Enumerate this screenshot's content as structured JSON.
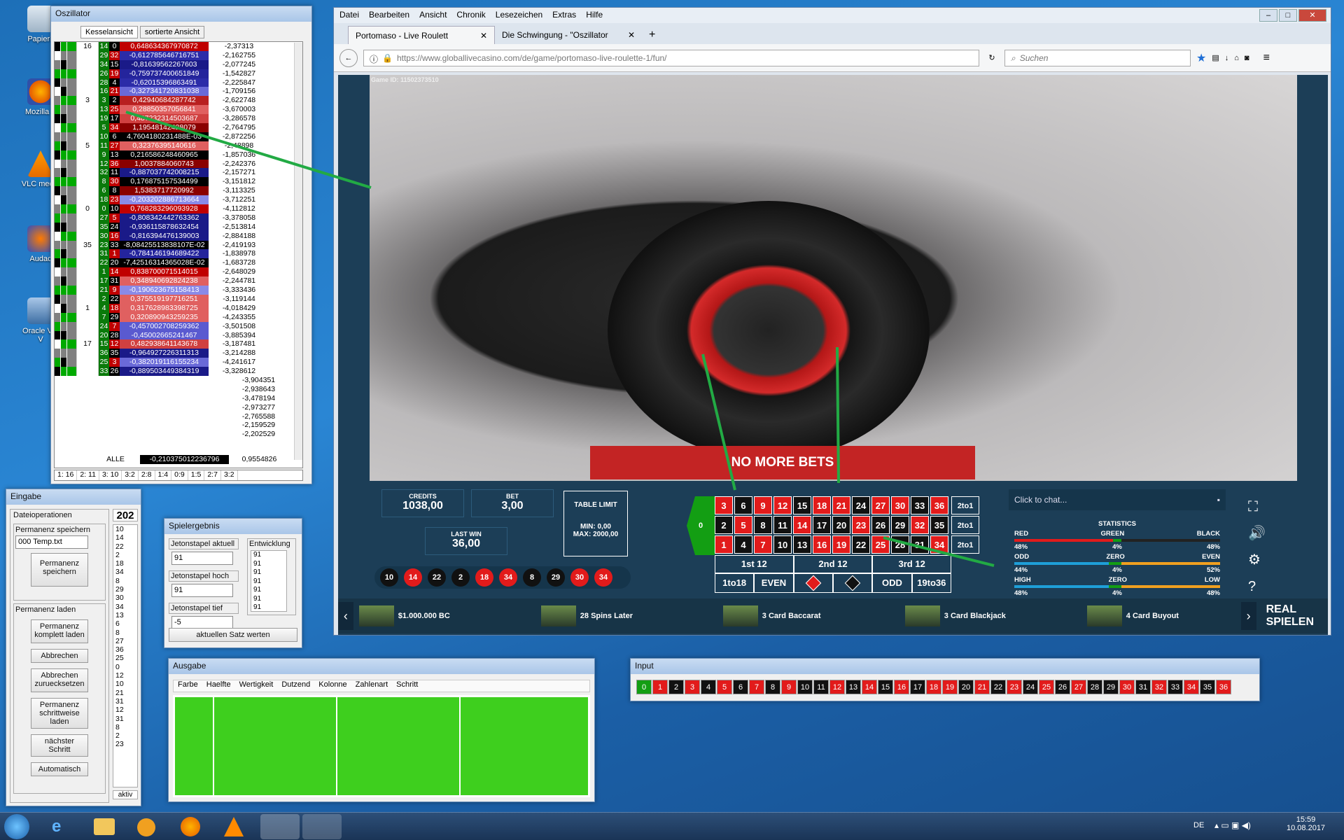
{
  "desktop": {
    "icons": [
      "Papierk",
      "Mozilla F",
      "VLC media",
      "Audac",
      "Oracle VM V"
    ]
  },
  "osz": {
    "title": "Oszillator",
    "tabs": [
      "Kesselansicht",
      "sortierte Ansicht"
    ],
    "groups": [
      "16",
      "3",
      "5",
      "0",
      "35",
      "1",
      "17"
    ],
    "rows": [
      {
        "n1": "14",
        "n2": "0",
        "v": "0,648634367970872",
        "v2": "-2,37313",
        "bg": "#c00000"
      },
      {
        "n1": "29",
        "n2": "32",
        "v": "-0,612785646716751",
        "v2": "-2,162755",
        "bg": "#2c2ca8"
      },
      {
        "n1": "34",
        "n2": "15",
        "v": "-0,81639562267603",
        "v2": "-2,077245",
        "bg": "#1a1a88"
      },
      {
        "n1": "26",
        "n2": "19",
        "v": "-0,759737400651849",
        "v2": "-1,542827",
        "bg": "#24249c"
      },
      {
        "n1": "28",
        "n2": "4",
        "v": "-0,62015396863491",
        "v2": "-2,225847",
        "bg": "#2c2ca8"
      },
      {
        "n1": "16",
        "n2": "21",
        "v": "-0,327341720831038",
        "v2": "-1,709156",
        "bg": "#6a6ad8"
      },
      {
        "n1": "3",
        "n2": "2",
        "v": "0,42940684287742",
        "v2": "-2,622748",
        "bg": "#b82020"
      },
      {
        "n1": "13",
        "n2": "25",
        "v": "0,28850357056841",
        "v2": "-3,670003",
        "bg": "#e06060"
      },
      {
        "n1": "19",
        "n2": "17",
        "v": "0,487232314503687",
        "v2": "-3,286578",
        "bg": "#d04040"
      },
      {
        "n1": "5",
        "n2": "34",
        "v": "1,19548142428079",
        "v2": "-2,764795",
        "bg": "#8a0000"
      },
      {
        "n1": "10",
        "n2": "6",
        "v": "4,7604180231488E-03",
        "v2": "-2,872256",
        "bg": "#000000"
      },
      {
        "n1": "11",
        "n2": "27",
        "v": "0,32376395140616",
        "v2": "-2,48898",
        "bg": "#e06060"
      },
      {
        "n1": "9",
        "n2": "13",
        "v": "0,216586248460965",
        "v2": "-1,857036",
        "bg": "#000000"
      },
      {
        "n1": "12",
        "n2": "36",
        "v": "1,0037884060743",
        "v2": "-2,242376",
        "bg": "#8a0000"
      },
      {
        "n1": "32",
        "n2": "11",
        "v": "-0,887037742008215",
        "v2": "-2,157271",
        "bg": "#1a1a88"
      },
      {
        "n1": "8",
        "n2": "30",
        "v": "0,176875157534499",
        "v2": "-3,151812",
        "bg": "#000000"
      },
      {
        "n1": "6",
        "n2": "8",
        "v": "1,5383717720992",
        "v2": "-3,113325",
        "bg": "#8a0000"
      },
      {
        "n1": "18",
        "n2": "23",
        "v": "-0,203202886713664",
        "v2": "-3,712251",
        "bg": "#8a8ae8"
      },
      {
        "n1": "0",
        "n2": "10",
        "v": "0,768283296093928",
        "v2": "-4,112812",
        "bg": "#c00000"
      },
      {
        "n1": "27",
        "n2": "5",
        "v": "-0,808342442763362",
        "v2": "-3,378058",
        "bg": "#1a1a88"
      },
      {
        "n1": "35",
        "n2": "24",
        "v": "-0,936115878632454",
        "v2": "-2,513814",
        "bg": "#1a1a88"
      },
      {
        "n1": "30",
        "n2": "16",
        "v": "-0,816394476139003",
        "v2": "-2,884188",
        "bg": "#1a1a88"
      },
      {
        "n1": "23",
        "n2": "33",
        "v": "-8,08425513838107E-02",
        "v2": "-2,419193",
        "bg": "#000000"
      },
      {
        "n1": "31",
        "n2": "1",
        "v": "-0,784146194689422",
        "v2": "-1,838978",
        "bg": "#24249c"
      },
      {
        "n1": "22",
        "n2": "20",
        "v": "-7,42516314365028E-02",
        "v2": "-1,683728",
        "bg": "#000000"
      },
      {
        "n1": "1",
        "n2": "14",
        "v": "0,838700071514015",
        "v2": "-2,648029",
        "bg": "#c00000"
      },
      {
        "n1": "17",
        "n2": "31",
        "v": "0,348940692824238",
        "v2": "-2,244781",
        "bg": "#e06060"
      },
      {
        "n1": "21",
        "n2": "9",
        "v": "-0,190623675158413",
        "v2": "-3,333436",
        "bg": "#8a8ae8"
      },
      {
        "n1": "2",
        "n2": "22",
        "v": "0,375519197716251",
        "v2": "-3,119144",
        "bg": "#e06060"
      },
      {
        "n1": "4",
        "n2": "18",
        "v": "0,317628983398725",
        "v2": "-4,018429",
        "bg": "#e06060"
      },
      {
        "n1": "7",
        "n2": "29",
        "v": "0,320890943259235",
        "v2": "-4,243355",
        "bg": "#e06060"
      },
      {
        "n1": "24",
        "n2": "7",
        "v": "-0,457002708259362",
        "v2": "-3,501508",
        "bg": "#5a5ad0"
      },
      {
        "n1": "20",
        "n2": "28",
        "v": "-0,45002665241467",
        "v2": "-3,885394",
        "bg": "#5a5ad0"
      },
      {
        "n1": "15",
        "n2": "12",
        "v": "0,482938641143678",
        "v2": "-3,187481",
        "bg": "#d04040"
      },
      {
        "n1": "36",
        "n2": "35",
        "v": "-0,964927226311313",
        "v2": "-3,214288",
        "bg": "#1a1a88"
      },
      {
        "n1": "25",
        "n2": "3",
        "v": "-0,382019116155234",
        "v2": "-4,241617",
        "bg": "#6a6ad8"
      },
      {
        "n1": "33",
        "n2": "26",
        "v": "-0,889503449384319",
        "v2": "-3,328612",
        "bg": "#1a1a88"
      }
    ],
    "extra_v2": [
      "-3,904351",
      "-2,938643",
      "-3,478194",
      "-2,973277",
      "-2,765588",
      "-2,159529",
      "-2,202529"
    ],
    "alle_label": "ALLE",
    "alle_val": "-0,210375012236796",
    "alle_v2": "0,9554826",
    "footer": [
      "1: 16",
      "2: 11",
      "3: 10",
      "3:2",
      "2:8",
      "1:4",
      "0:9",
      "1:5",
      "2:7",
      "3:2"
    ]
  },
  "ff": {
    "menu": [
      "Datei",
      "Bearbeiten",
      "Ansicht",
      "Chronik",
      "Lesezeichen",
      "Extras",
      "Hilfe"
    ],
    "tab1": "Portomaso - Live Roulett",
    "tab2": "Die Schwingung - \"Oszillator",
    "new_tab": "+",
    "url_host": "https://www.globallivecasino.com",
    "url_path": "/de/game/portomaso-live-roulette-1/fun/",
    "search": "Suchen"
  },
  "game": {
    "game_id": "Game ID: 11502373510",
    "no_more": "NO MORE BETS",
    "credits_label": "CREDITS",
    "credits": "1038,00",
    "bet_label": "BET",
    "bet": "3,00",
    "limit_label": "TABLE LIMIT",
    "limit_min": "MIN: 0,00",
    "limit_max": "MAX: 2000,00",
    "lastwin_label": "LAST WIN",
    "lastwin": "36,00",
    "history": [
      {
        "n": "10",
        "c": "blk"
      },
      {
        "n": "14",
        "c": "red"
      },
      {
        "n": "22",
        "c": "blk"
      },
      {
        "n": "2",
        "c": "blk"
      },
      {
        "n": "18",
        "c": "red"
      },
      {
        "n": "34",
        "c": "red"
      },
      {
        "n": "8",
        "c": "blk"
      },
      {
        "n": "29",
        "c": "blk"
      },
      {
        "n": "30",
        "c": "red"
      },
      {
        "n": "34",
        "c": "red"
      }
    ],
    "zero": "0",
    "grid": [
      [
        {
          "n": "3",
          "c": "red"
        },
        {
          "n": "6",
          "c": "blk"
        },
        {
          "n": "9",
          "c": "red"
        },
        {
          "n": "12",
          "c": "red"
        },
        {
          "n": "15",
          "c": "blk"
        },
        {
          "n": "18",
          "c": "red"
        },
        {
          "n": "21",
          "c": "red"
        },
        {
          "n": "24",
          "c": "blk"
        },
        {
          "n": "27",
          "c": "red"
        },
        {
          "n": "30",
          "c": "red"
        },
        {
          "n": "33",
          "c": "blk"
        },
        {
          "n": "36",
          "c": "red"
        }
      ],
      [
        {
          "n": "2",
          "c": "blk"
        },
        {
          "n": "5",
          "c": "red"
        },
        {
          "n": "8",
          "c": "blk"
        },
        {
          "n": "11",
          "c": "blk"
        },
        {
          "n": "14",
          "c": "red"
        },
        {
          "n": "17",
          "c": "blk"
        },
        {
          "n": "20",
          "c": "blk"
        },
        {
          "n": "23",
          "c": "red"
        },
        {
          "n": "26",
          "c": "blk"
        },
        {
          "n": "29",
          "c": "blk"
        },
        {
          "n": "32",
          "c": "red"
        },
        {
          "n": "35",
          "c": "blk"
        }
      ],
      [
        {
          "n": "1",
          "c": "red"
        },
        {
          "n": "4",
          "c": "blk"
        },
        {
          "n": "7",
          "c": "red"
        },
        {
          "n": "10",
          "c": "blk"
        },
        {
          "n": "13",
          "c": "blk"
        },
        {
          "n": "16",
          "c": "red"
        },
        {
          "n": "19",
          "c": "red"
        },
        {
          "n": "22",
          "c": "blk"
        },
        {
          "n": "25",
          "c": "red"
        },
        {
          "n": "28",
          "c": "blk"
        },
        {
          "n": "31",
          "c": "blk"
        },
        {
          "n": "34",
          "c": "red"
        }
      ]
    ],
    "col_bet": "2to1",
    "dozens": [
      "1st 12",
      "2nd 12",
      "3rd 12"
    ],
    "outside": [
      "1to18",
      "EVEN",
      "",
      "",
      "ODD",
      "19to36"
    ],
    "chat": "Click to chat...",
    "stats_title": "STATISTICS",
    "stats": [
      {
        "l": "RED",
        "m": "GREEN",
        "r": "BLACK",
        "lv": "48%",
        "mv": "4%",
        "rv": "48%"
      },
      {
        "l": "ODD",
        "m": "ZERO",
        "r": "EVEN",
        "lv": "44%",
        "mv": "4%",
        "rv": "52%"
      },
      {
        "l": "HIGH",
        "m": "ZERO",
        "r": "LOW",
        "lv": "48%",
        "mv": "4%",
        "rv": "48%"
      }
    ],
    "promos": [
      "$1.000.000 BC",
      "28 Spins Later",
      "3 Card Baccarat",
      "3 Card Blackjack",
      "4 Card Buyout"
    ],
    "real": "REAL SPIELEN"
  },
  "eingabe": {
    "title": "Eingabe",
    "count": "202",
    "dateiops": "Dateioperationen",
    "perm_save_label": "Permanenz speichern",
    "perm_file": "000 Temp.txt",
    "save_btn": "Permanenz speichern",
    "load_label": "Permanenz laden",
    "btns": [
      "Permanenz komplett laden",
      "Abbrechen",
      "Abbrechen zuruecksetzen",
      "Permanenz schrittweise laden",
      "nächster Schritt",
      "Automatisch"
    ],
    "numbers": [
      "10",
      "14",
      "22",
      "2",
      "18",
      "34",
      "8",
      "29",
      "30",
      "34",
      "13",
      "6",
      "8",
      "27",
      "36",
      "25",
      "0",
      "12",
      "10",
      "21",
      "31",
      "12",
      "31",
      "8",
      "2",
      "23"
    ],
    "aktiv": "aktiv"
  },
  "spieler": {
    "title": "Spielergebnis",
    "akt_label": "Jetonstapel aktuell",
    "akt": "91",
    "hoch_label": "Jetonstapel hoch",
    "hoch": "91",
    "tief_label": "Jetonstapel tief",
    "tief": "-5",
    "entw_label": "Entwicklung",
    "entw": [
      "91",
      "91",
      "91",
      "91",
      "91",
      "91",
      "91"
    ],
    "btn": "aktuellen Satz werten"
  },
  "ausgabe": {
    "title": "Ausgabe",
    "cols": [
      "Farbe",
      "Haelfte",
      "Wertigkeit",
      "Dutzend",
      "Kolonne",
      "Zahlenart",
      "Schritt"
    ]
  },
  "input": {
    "title": "Input",
    "cells": [
      {
        "n": "0",
        "c": "grn"
      },
      {
        "n": "1",
        "c": "red"
      },
      {
        "n": "2",
        "c": "blk"
      },
      {
        "n": "3",
        "c": "red"
      },
      {
        "n": "4",
        "c": "blk"
      },
      {
        "n": "5",
        "c": "red"
      },
      {
        "n": "6",
        "c": "blk"
      },
      {
        "n": "7",
        "c": "red"
      },
      {
        "n": "8",
        "c": "blk"
      },
      {
        "n": "9",
        "c": "red"
      },
      {
        "n": "10",
        "c": "blk"
      },
      {
        "n": "11",
        "c": "blk"
      },
      {
        "n": "12",
        "c": "red"
      },
      {
        "n": "13",
        "c": "blk"
      },
      {
        "n": "14",
        "c": "red"
      },
      {
        "n": "15",
        "c": "blk"
      },
      {
        "n": "16",
        "c": "red"
      },
      {
        "n": "17",
        "c": "blk"
      },
      {
        "n": "18",
        "c": "red"
      },
      {
        "n": "19",
        "c": "red"
      },
      {
        "n": "20",
        "c": "blk"
      },
      {
        "n": "21",
        "c": "red"
      },
      {
        "n": "22",
        "c": "blk"
      },
      {
        "n": "23",
        "c": "red"
      },
      {
        "n": "24",
        "c": "blk"
      },
      {
        "n": "25",
        "c": "red"
      },
      {
        "n": "26",
        "c": "blk"
      },
      {
        "n": "27",
        "c": "red"
      },
      {
        "n": "28",
        "c": "blk"
      },
      {
        "n": "29",
        "c": "blk"
      },
      {
        "n": "30",
        "c": "red"
      },
      {
        "n": "31",
        "c": "blk"
      },
      {
        "n": "32",
        "c": "red"
      },
      {
        "n": "33",
        "c": "blk"
      },
      {
        "n": "34",
        "c": "red"
      },
      {
        "n": "35",
        "c": "blk"
      },
      {
        "n": "36",
        "c": "red"
      }
    ]
  },
  "taskbar": {
    "lang": "DE",
    "time": "15:59",
    "date": "10.08.2017"
  }
}
